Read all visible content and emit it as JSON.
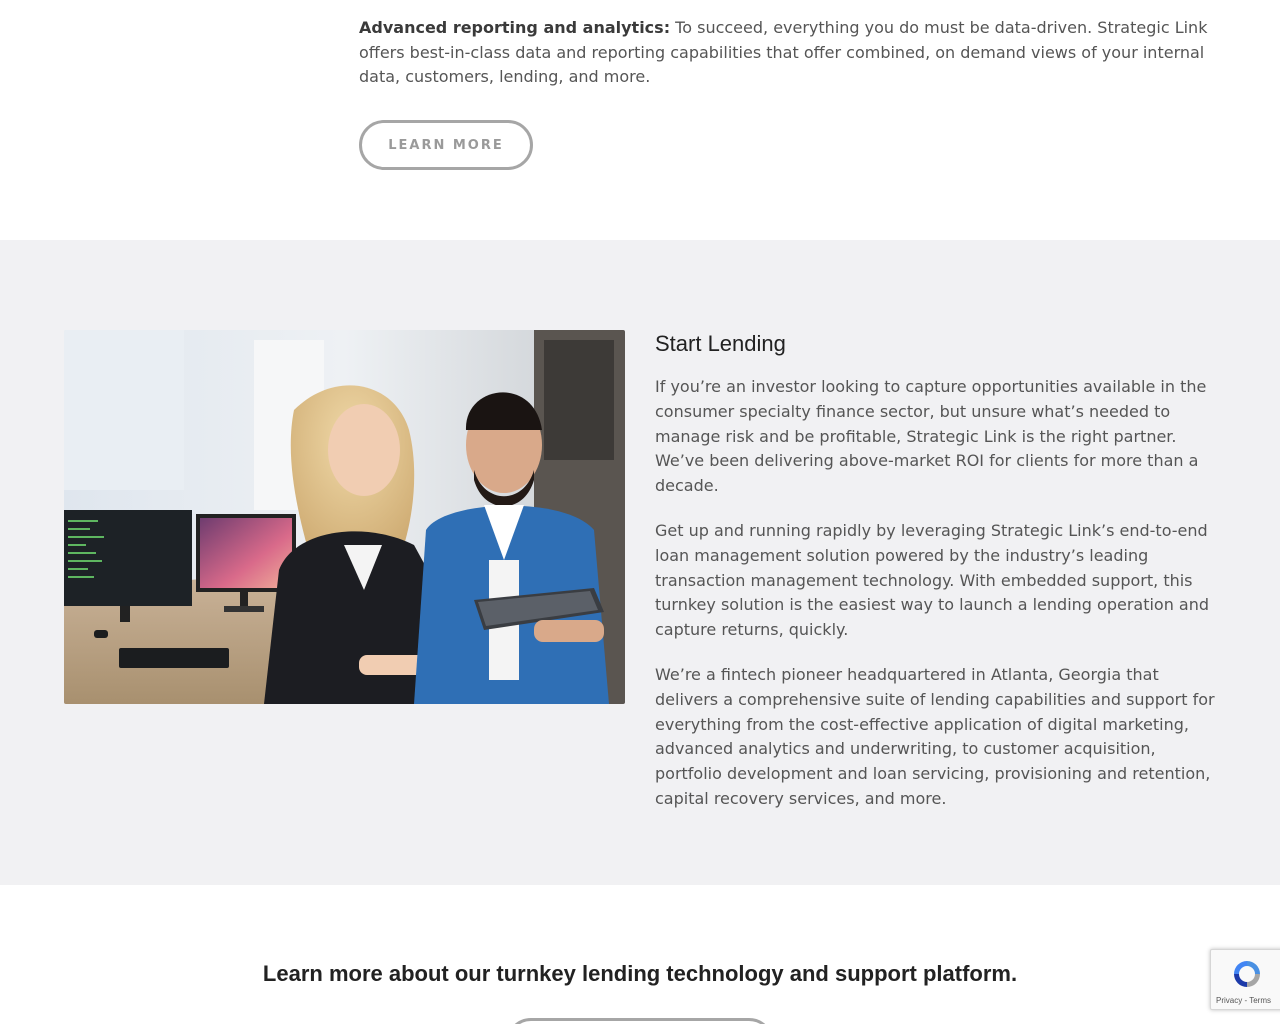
{
  "top": {
    "bold_lead": "Advanced reporting and analytics:",
    "body": " To succeed, everything you do must be data-driven. Strategic Link offers best-in-class data and reporting capabilities that offer combined, on demand views of your internal data, customers, lending, and more.",
    "button_label": "LEARN MORE"
  },
  "start_lending": {
    "title": "Start Lending",
    "paragraphs": [
      "If you’re an investor looking to capture opportunities available in the consumer specialty finance sector, but unsure what’s needed to manage risk and be profitable, Strategic Link is the right partner. We’ve been delivering above-market ROI for clients for more than a decade.",
      "Get up and running rapidly by leveraging Strategic Link’s end-to-end loan management solution powered by the industry’s leading transaction management technology. With embedded support, this turnkey solution is the easiest way to launch a lending operation and capture returns, quickly.",
      "We’re a fintech pioneer headquartered in Atlanta, Georgia that delivers a comprehensive suite of lending capabilities and support for everything from the cost-effective application of digital marketing, advanced analytics and underwriting, to customer acquisition, portfolio development and loan servicing, provisioning and retention, capital recovery services, and more."
    ]
  },
  "cta": {
    "text": "Learn more about our turnkey lending technology and support platform."
  },
  "recaptcha": {
    "privacy": "Privacy",
    "separator": " - ",
    "terms": "Terms"
  },
  "colors": {
    "gray_bg": "#f1f1f3",
    "button_border": "#a6a6a6",
    "body_text": "#555555"
  }
}
